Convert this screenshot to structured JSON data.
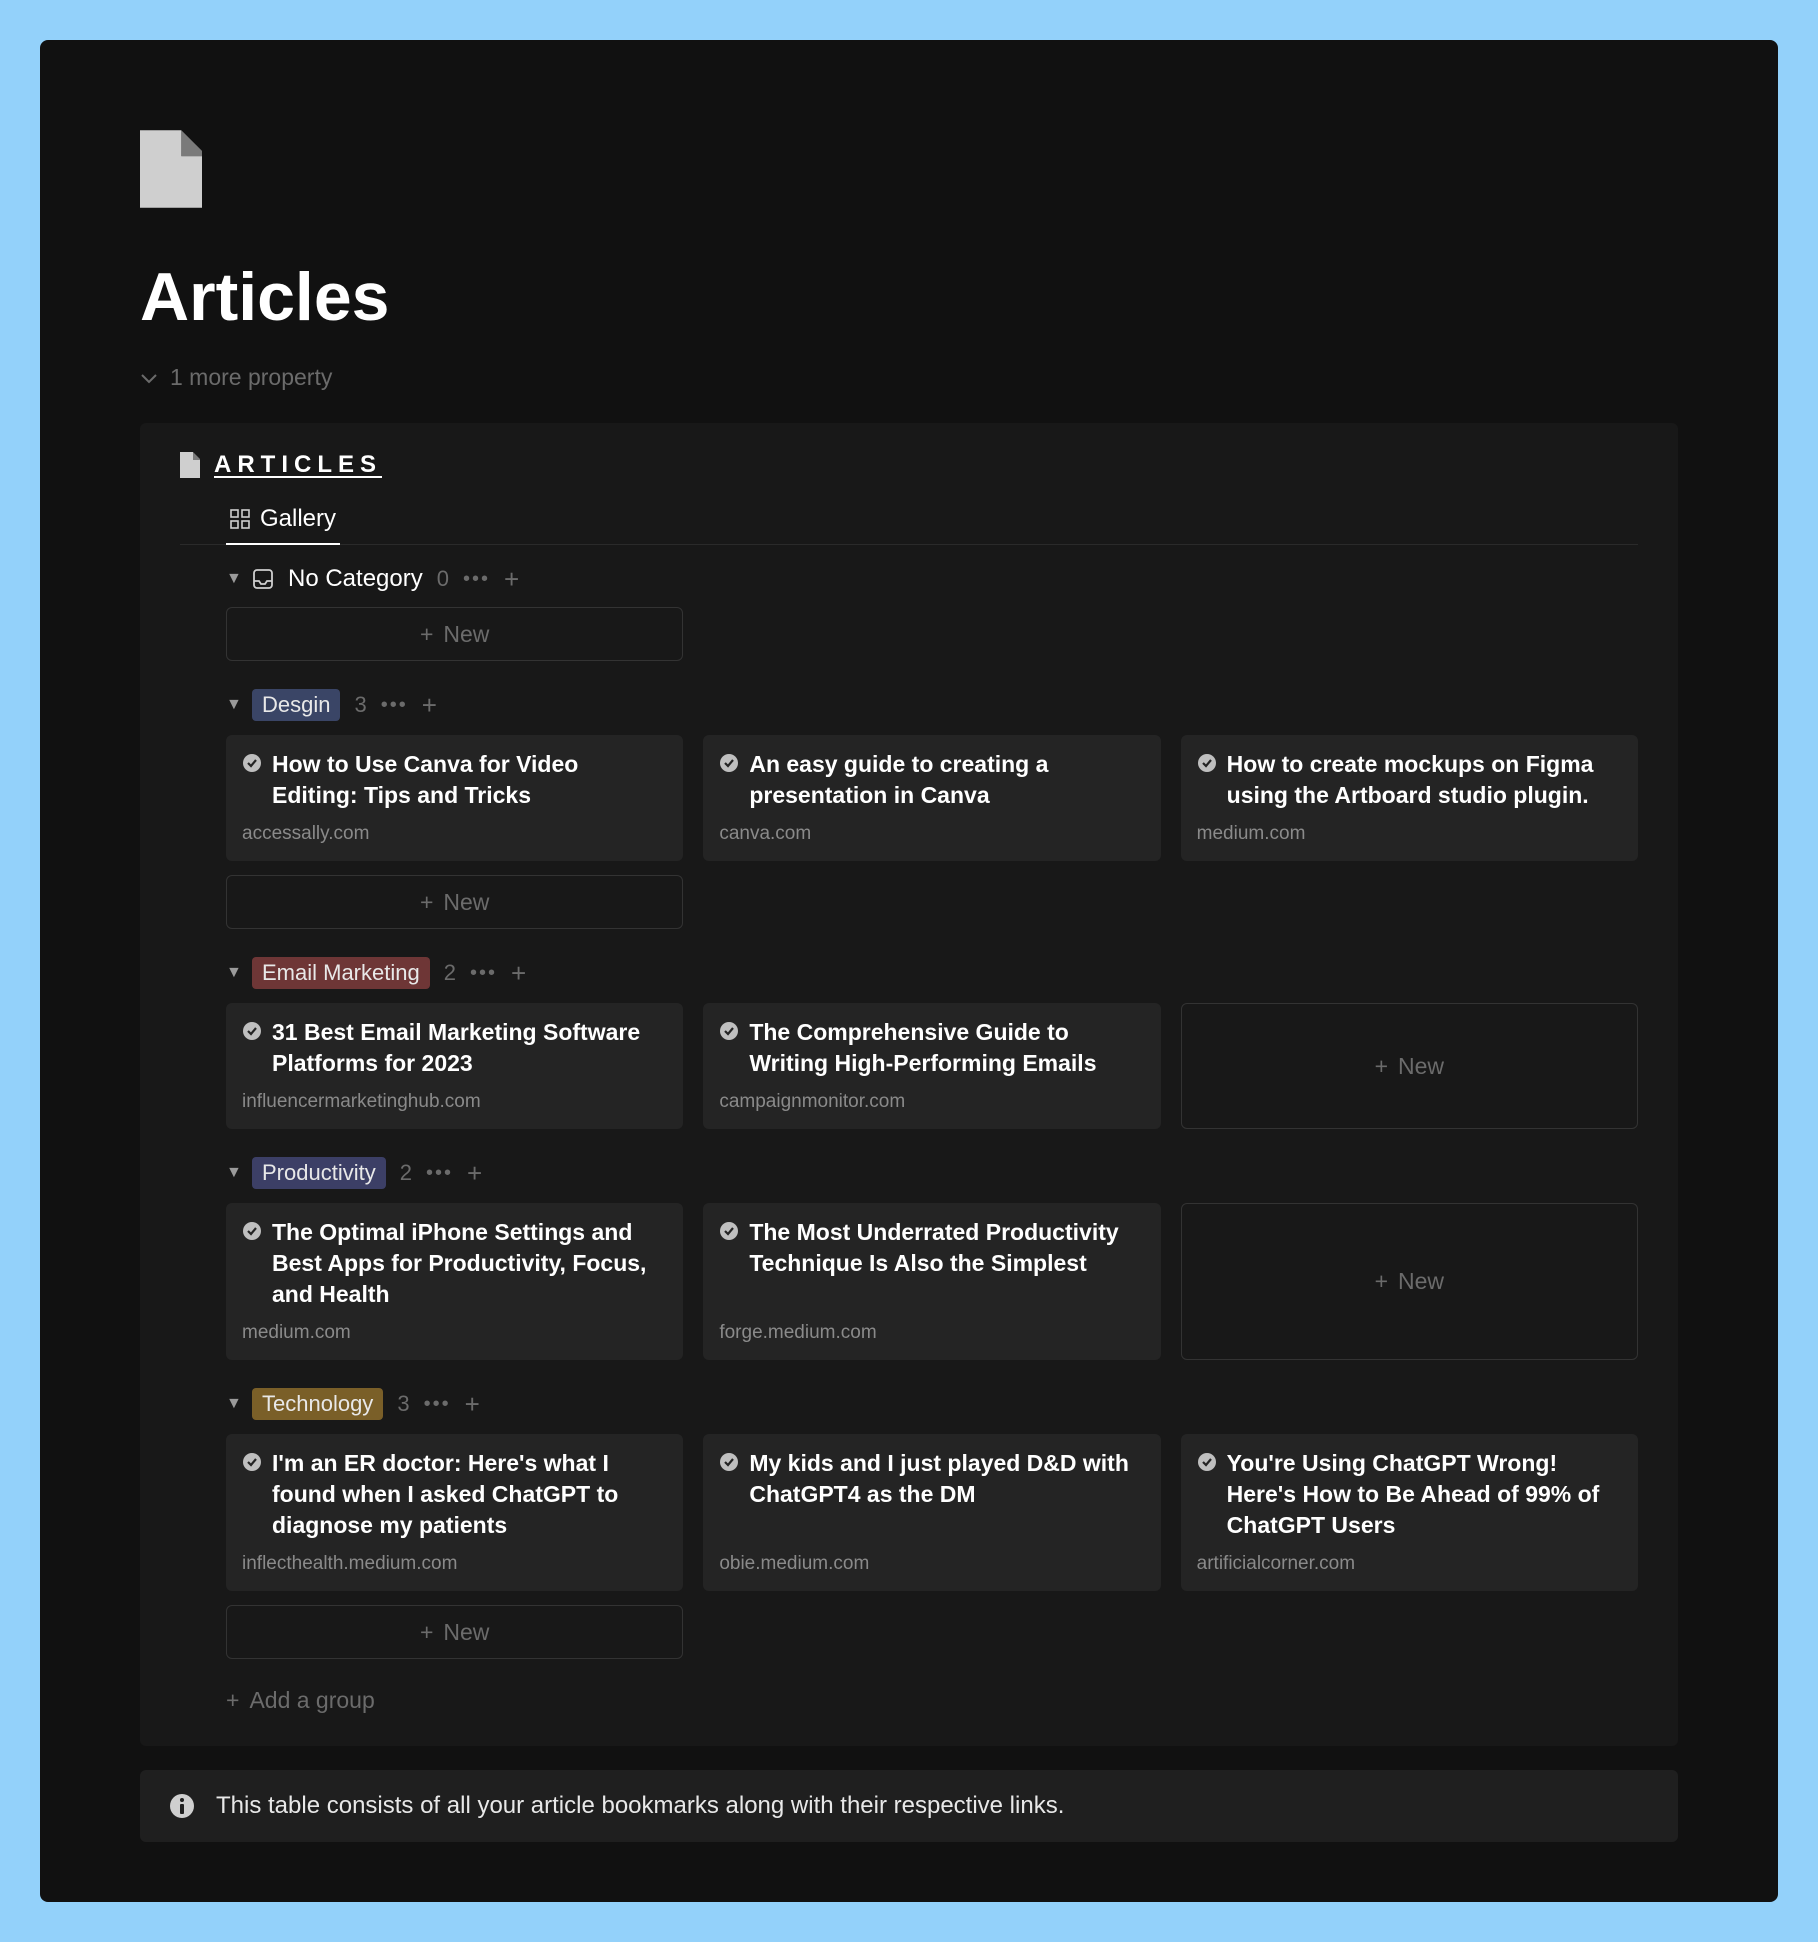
{
  "page": {
    "title": "Articles",
    "more_properties": "1 more property"
  },
  "linked_db": {
    "title": "ARTICLES",
    "tab": "Gallery",
    "new_label": "New",
    "add_group": "Add a group",
    "groups": [
      {
        "key": "nocat",
        "name": "No Category",
        "count": "0",
        "plain": true,
        "show_icon": true,
        "cards": []
      },
      {
        "key": "design",
        "name": "Desgin",
        "count": "3",
        "tag_class": "tag-design",
        "cards": [
          {
            "title": "How to Use Canva for Video Editing: Tips and Tricks",
            "source": "accessally.com"
          },
          {
            "title": "An easy guide to creating a presentation in Canva",
            "source": "canva.com"
          },
          {
            "title": "How to create mockups on Figma using the Artboard studio plugin.",
            "source": "medium.com"
          }
        ]
      },
      {
        "key": "email",
        "name": "Email Marketing",
        "count": "2",
        "tag_class": "tag-email",
        "cards": [
          {
            "title": "31 Best Email Marketing Software Platforms for 2023",
            "source": "influencermarketinghub.com"
          },
          {
            "title": "The Comprehensive Guide to Writing High-Performing Emails",
            "source": "campaignmonitor.com"
          }
        ]
      },
      {
        "key": "productivity",
        "name": "Productivity",
        "count": "2",
        "tag_class": "tag-productivity",
        "cards": [
          {
            "title": "The Optimal iPhone Settings and Best Apps for Productivity, Focus, and Health",
            "source": "medium.com"
          },
          {
            "title": "The Most Underrated Productivity Technique Is Also the Simplest",
            "source": "forge.medium.com"
          }
        ]
      },
      {
        "key": "technology",
        "name": "Technology",
        "count": "3",
        "tag_class": "tag-technology",
        "cards": [
          {
            "title": "I'm an ER doctor: Here's what I found when I asked ChatGPT to diagnose my patients",
            "source": "inflecthealth.medium.com"
          },
          {
            "title": "My kids and I just played D&D with ChatGPT4 as the DM",
            "source": "obie.medium.com"
          },
          {
            "title": "You're Using ChatGPT Wrong! Here's How to Be Ahead of 99% of ChatGPT Users",
            "source": "artificialcorner.com"
          }
        ]
      }
    ]
  },
  "callout": {
    "text": "This table consists of all your article bookmarks along with their respective links."
  }
}
